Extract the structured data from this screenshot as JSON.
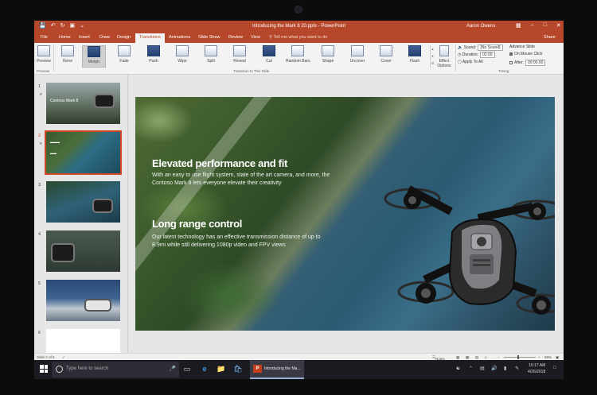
{
  "window": {
    "title": "Introducing the Mark 8 20.pptx - PowerPoint",
    "user": "Aaron Owens"
  },
  "tabs": [
    "File",
    "Home",
    "Insert",
    "Draw",
    "Design",
    "Transitions",
    "Animations",
    "Slide Show",
    "Review",
    "View"
  ],
  "active_tab": "Transitions",
  "tell_me": "Tell me what you want to do",
  "share": "Share",
  "ribbon": {
    "preview": "Preview",
    "transitions": [
      "None",
      "Morph",
      "Fade",
      "Push",
      "Wipe",
      "Split",
      "Reveal",
      "Cut",
      "Random Bars",
      "Shape",
      "Uncover",
      "Cover",
      "Flash"
    ],
    "selected_transition": "Morph",
    "effect_options": "Effect Options",
    "group_transition_label": "Transition to This Slide",
    "group_timing_label": "Timing",
    "sound_label": "Sound:",
    "sound_value": "[No Sound]",
    "duration_label": "Duration:",
    "duration_value": "02.00",
    "apply_all": "Apply To All",
    "advance_label": "Advance Slide",
    "on_mouse_click": "On Mouse Click",
    "after_label": "After:",
    "after_value": "00:00.00",
    "preview_group_label": "Preview"
  },
  "thumbnails": [
    {
      "num": "1",
      "title": "Contoso Mark 8"
    },
    {
      "num": "2",
      "title": ""
    },
    {
      "num": "3",
      "title": ""
    },
    {
      "num": "4",
      "title": ""
    },
    {
      "num": "5",
      "title": ""
    },
    {
      "num": "6",
      "title": ""
    }
  ],
  "selected_slide": 2,
  "slide": {
    "heading1": "Elevated performance and fit",
    "body1": "With an easy to use flight system, state of the art camera, and more, the Contoso Mark 8 lets everyone elevate their creativity",
    "heading2": "Long range control",
    "body2": "Our latest technology has an effective transmission distance of up to 8.9mi while still delivering 1080p video and FPV views"
  },
  "statusbar": {
    "slide_info": "Slide 2 of 6",
    "notes": "Notes",
    "zoom": "89%"
  },
  "taskbar": {
    "search_placeholder": "Type here to search",
    "app_name": "Introducing the Ma...",
    "time": "10:17 AM",
    "date": "4/26/2018"
  }
}
